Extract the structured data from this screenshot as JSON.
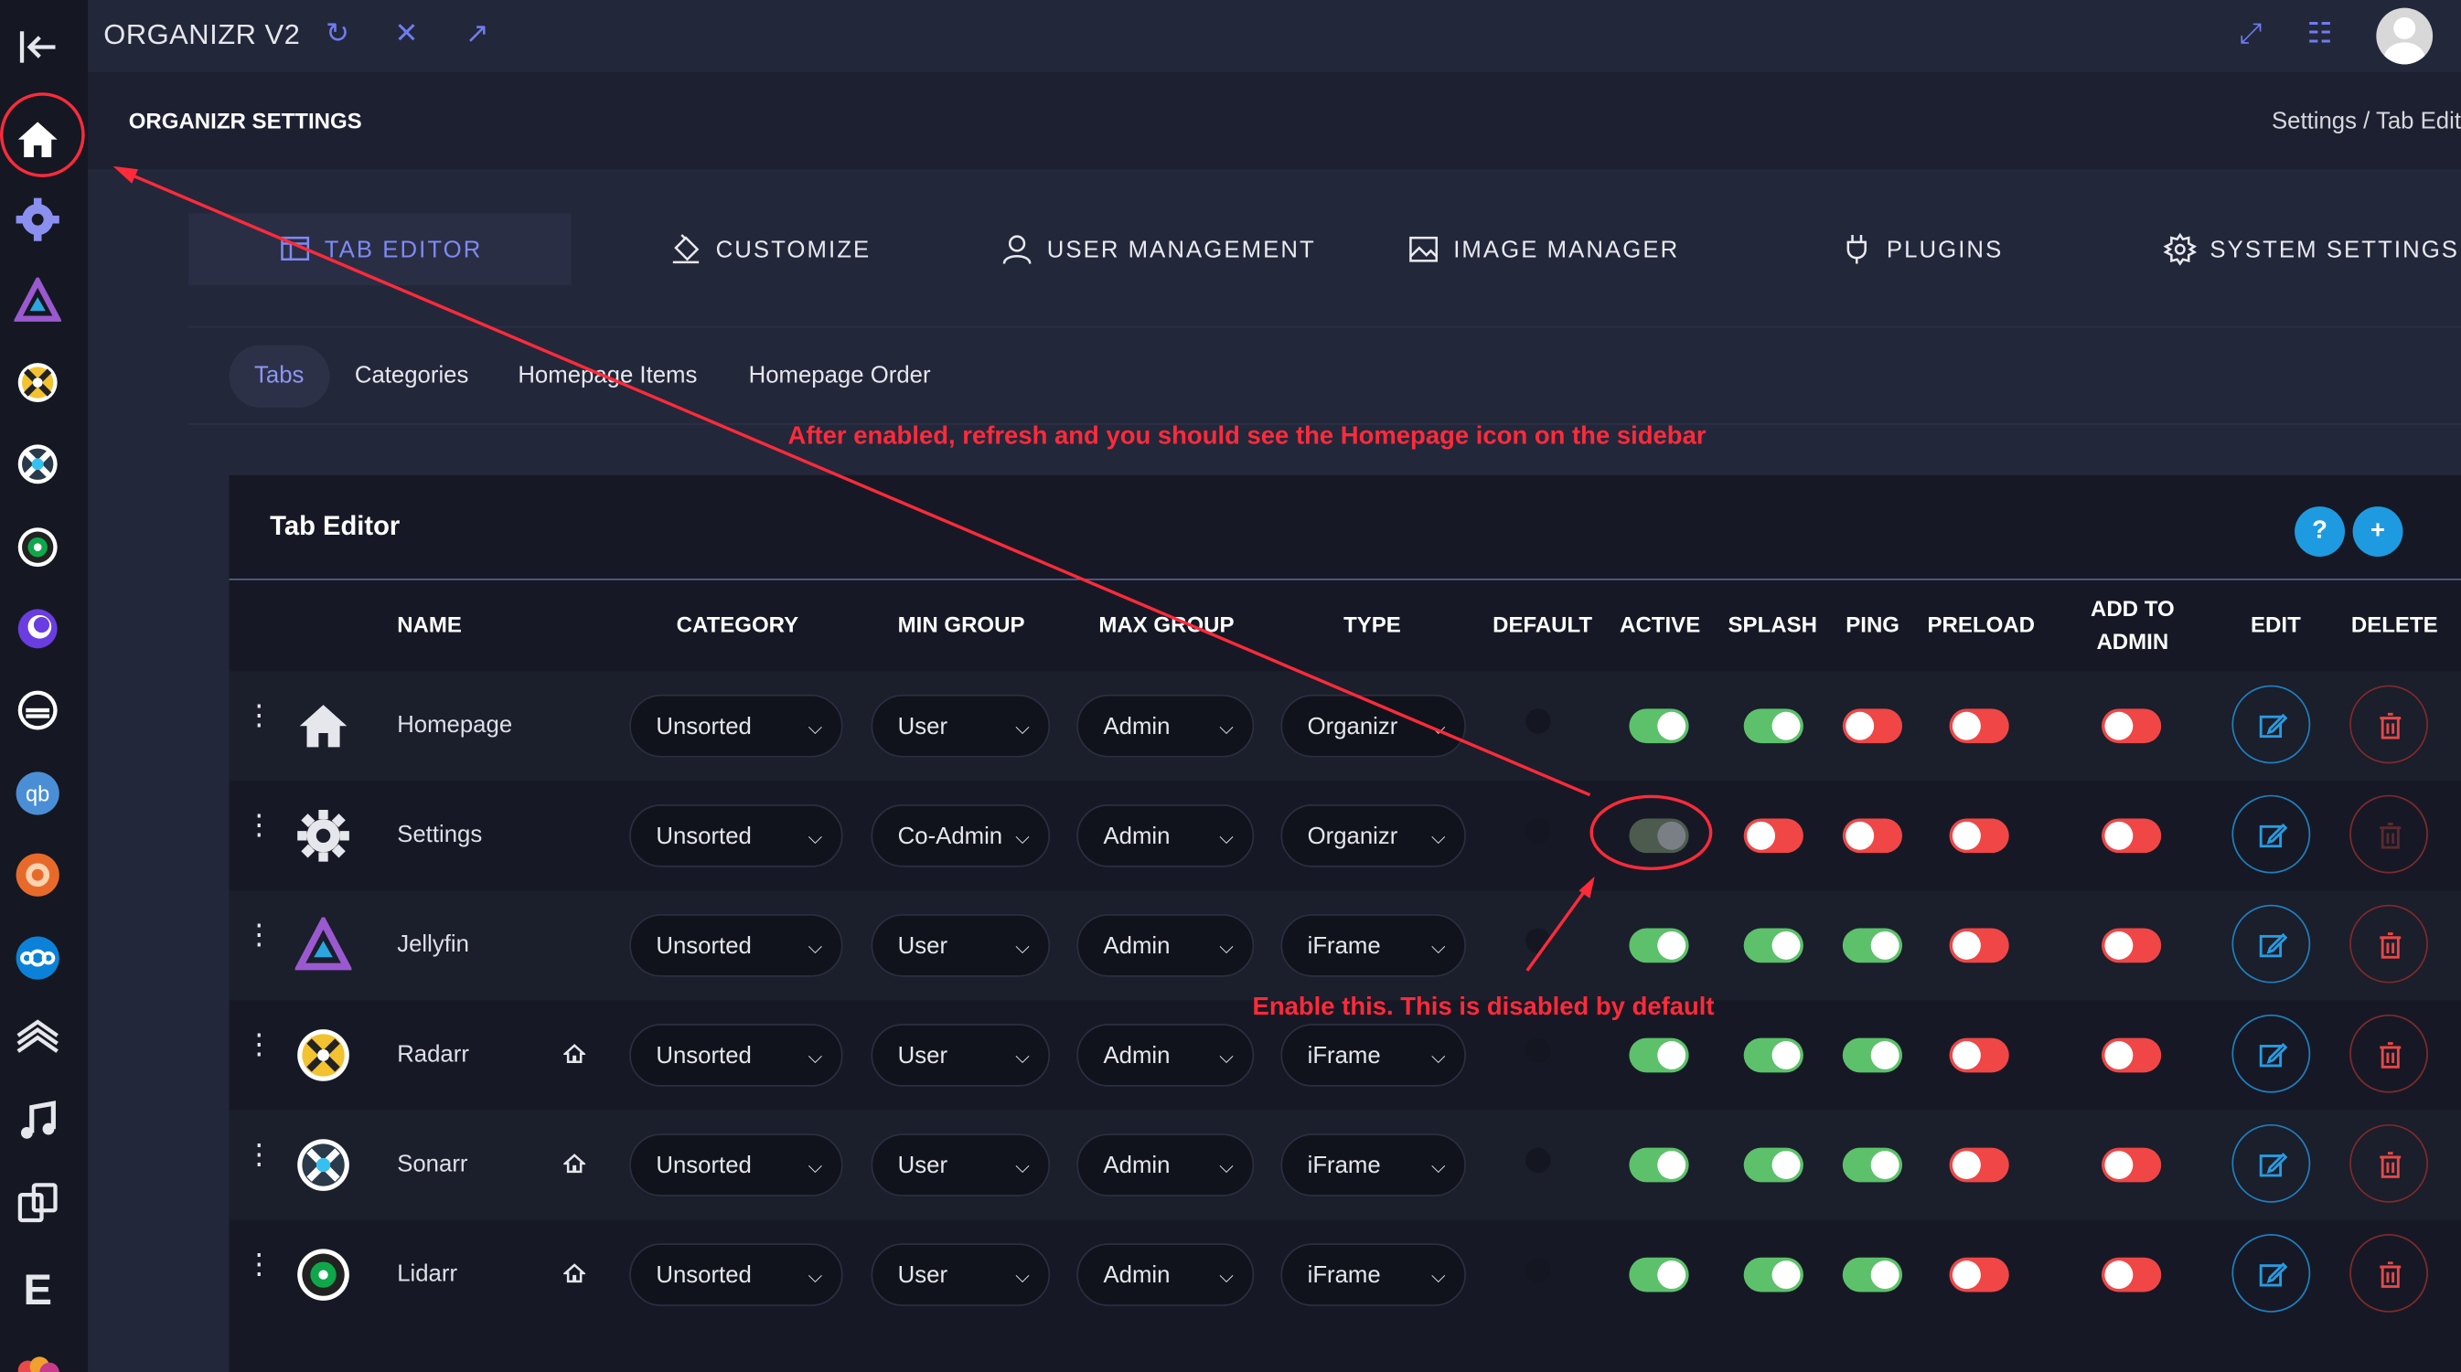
{
  "app": {
    "title": "ORGANIZR V2"
  },
  "page": {
    "title": "ORGANIZR SETTINGS",
    "breadcrumb": "Settings / Tab Edit"
  },
  "main_tabs": [
    {
      "label": "TAB EDITOR",
      "icon": "tab-editor-icon",
      "active": true
    },
    {
      "label": "CUSTOMIZE",
      "icon": "paint-bucket-icon"
    },
    {
      "label": "USER MANAGEMENT",
      "icon": "user-icon"
    },
    {
      "label": "IMAGE MANAGER",
      "icon": "image-icon"
    },
    {
      "label": "PLUGINS",
      "icon": "plug-icon"
    },
    {
      "label": "SYSTEM SETTINGS",
      "icon": "gear-icon"
    }
  ],
  "sub_tabs": [
    {
      "label": "Tabs",
      "active": true
    },
    {
      "label": "Categories"
    },
    {
      "label": "Homepage Items"
    },
    {
      "label": "Homepage Order"
    }
  ],
  "panel": {
    "title": "Tab Editor",
    "help_label": "?",
    "add_label": "+"
  },
  "columns": {
    "name": "NAME",
    "category": "CATEGORY",
    "min_group": "MIN GROUP",
    "max_group": "MAX GROUP",
    "type": "TYPE",
    "default": "DEFAULT",
    "active": "ACTIVE",
    "splash": "SPLASH",
    "ping": "PING",
    "preload": "PRELOAD",
    "add_to_admin_1": "ADD TO",
    "add_to_admin_2": "ADMIN",
    "edit": "EDIT",
    "delete": "DELETE"
  },
  "rows": [
    {
      "name": "Homepage",
      "icon": "home-icon",
      "home_badge": false,
      "category": "Unsorted",
      "min_group": "User",
      "max_group": "Admin",
      "type": "Organizr",
      "active": "on",
      "splash": "on",
      "ping": "off",
      "preload": "off",
      "add_to_admin": "off"
    },
    {
      "name": "Settings",
      "icon": "gear-icon",
      "home_badge": false,
      "category": "Unsorted",
      "min_group": "Co-Admin",
      "max_group": "Admin",
      "type": "Organizr",
      "active": "disabled",
      "splash": "off",
      "ping": "off",
      "preload": "off",
      "add_to_admin": "off"
    },
    {
      "name": "Jellyfin",
      "icon": "jellyfin-icon",
      "home_badge": false,
      "category": "Unsorted",
      "min_group": "User",
      "max_group": "Admin",
      "type": "iFrame",
      "active": "on",
      "splash": "on",
      "ping": "on",
      "preload": "off",
      "add_to_admin": "off"
    },
    {
      "name": "Radarr",
      "icon": "radarr-icon",
      "home_badge": true,
      "category": "Unsorted",
      "min_group": "User",
      "max_group": "Admin",
      "type": "iFrame",
      "active": "on",
      "splash": "on",
      "ping": "on",
      "preload": "off",
      "add_to_admin": "off"
    },
    {
      "name": "Sonarr",
      "icon": "sonarr-icon",
      "home_badge": true,
      "category": "Unsorted",
      "min_group": "User",
      "max_group": "Admin",
      "type": "iFrame",
      "active": "on",
      "splash": "on",
      "ping": "on",
      "preload": "off",
      "add_to_admin": "off"
    },
    {
      "name": "Lidarr",
      "icon": "lidarr-icon",
      "home_badge": true,
      "category": "Unsorted",
      "min_group": "User",
      "max_group": "Admin",
      "type": "iFrame",
      "active": "on",
      "splash": "on",
      "ping": "on",
      "preload": "off",
      "add_to_admin": "off"
    }
  ],
  "annotations": {
    "top": "After enabled, refresh and you should see the Homepage icon on the sidebar",
    "bottom": "Enable this. This is disabled by default"
  },
  "colors": {
    "accent": "#7e8af2",
    "toggle_on": "#5cc16a",
    "toggle_off": "#f04646",
    "annotation": "#ff2a3a",
    "info_button": "#1e9be0"
  }
}
